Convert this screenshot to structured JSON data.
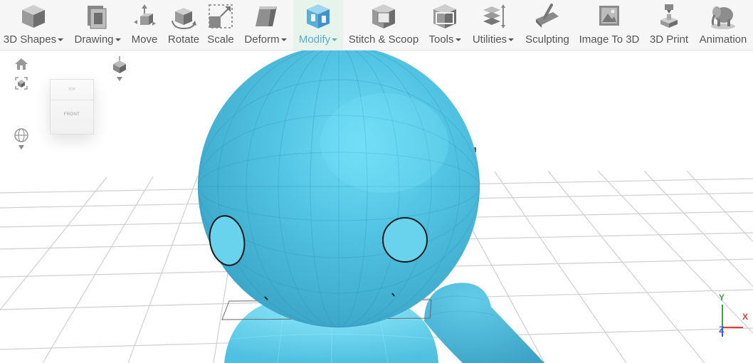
{
  "toolbar": {
    "items": [
      {
        "label": "3D Shapes",
        "icon": "cube-icon",
        "dropdown": true
      },
      {
        "label": "Drawing",
        "icon": "drawing-icon",
        "dropdown": true
      },
      {
        "label": "Move",
        "icon": "move-icon",
        "dropdown": false
      },
      {
        "label": "Rotate",
        "icon": "rotate-icon",
        "dropdown": false
      },
      {
        "label": "Scale",
        "icon": "scale-icon",
        "dropdown": false
      },
      {
        "label": "Deform",
        "icon": "deform-icon",
        "dropdown": true
      },
      {
        "label": "Modify",
        "icon": "modify-icon",
        "dropdown": true,
        "active": true
      },
      {
        "label": "Stitch & Scoop",
        "icon": "stitch-scoop-icon",
        "dropdown": false
      },
      {
        "label": "Tools",
        "icon": "tools-icon",
        "dropdown": true
      },
      {
        "label": "Utilities",
        "icon": "utilities-icon",
        "dropdown": true
      },
      {
        "label": "Sculpting",
        "icon": "sculpting-icon",
        "dropdown": false
      },
      {
        "label": "Image To 3D",
        "icon": "image-to-3d-icon",
        "dropdown": false
      },
      {
        "label": "3D Print",
        "icon": "3d-print-icon",
        "dropdown": false
      },
      {
        "label": "Animation",
        "icon": "animation-icon",
        "dropdown": false
      }
    ]
  },
  "viewcube": {
    "top_label": "TOP",
    "front_label": "FRONT"
  },
  "axes": {
    "y": "Y",
    "x": "X",
    "z": "Z"
  },
  "colors": {
    "toolbar_bg": "#f6f6f6",
    "active_bg": "#e6f4ec",
    "active_text": "#5aa9d8",
    "model": "#55c8e6",
    "grid": "#cfcfcf",
    "axis_x": "#e33b3b",
    "axis_y": "#3aa04a",
    "axis_z": "#3b5be3"
  }
}
